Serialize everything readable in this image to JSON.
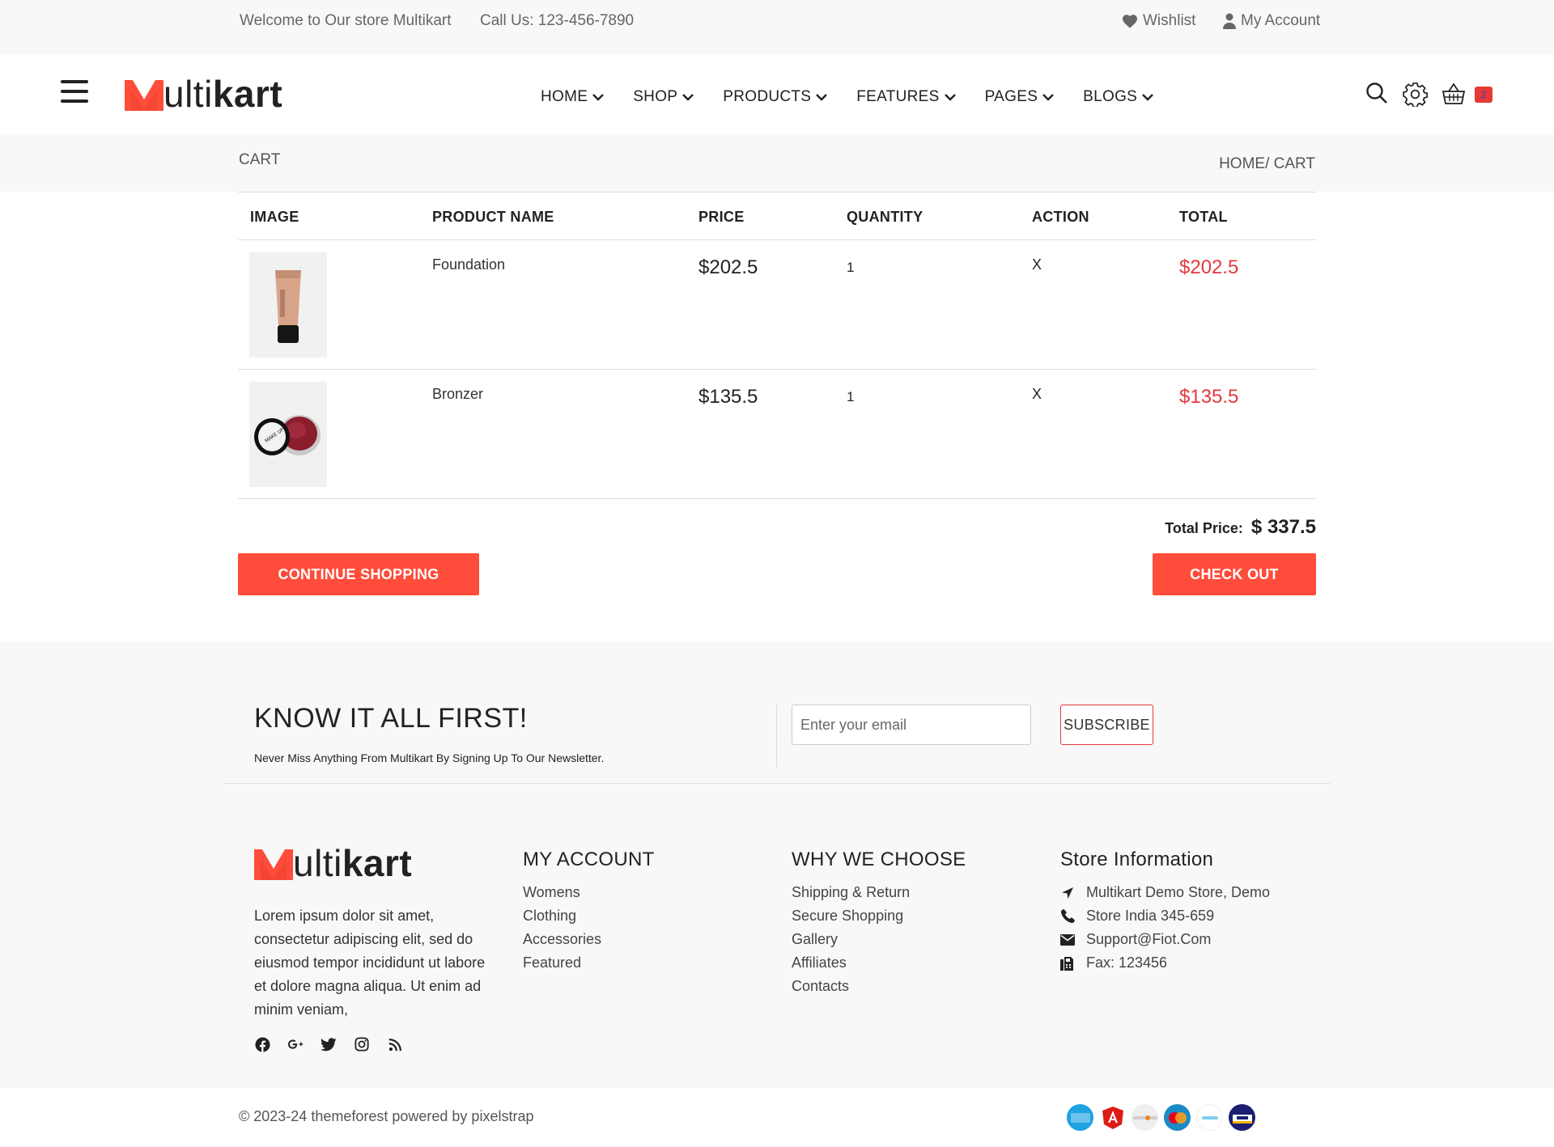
{
  "topbar": {
    "welcome": "Welcome to Our store Multikart",
    "call": "Call Us: 123-456-7890",
    "wishlist": "Wishlist",
    "account": "My Account"
  },
  "brand": {
    "prefix": "ultikart_light",
    "light": "ulti",
    "bold": "kart"
  },
  "nav": {
    "items": [
      "HOME",
      "SHOP",
      "PRODUCTS",
      "FEATURES",
      "PAGES",
      "BLOGS"
    ]
  },
  "header": {
    "cart_count": "2"
  },
  "breadcrumb": {
    "title": "CART",
    "path": "HOME/ CART"
  },
  "cart": {
    "columns": [
      "IMAGE",
      "PRODUCT NAME",
      "PRICE",
      "QUANTITY",
      "ACTION",
      "TOTAL"
    ],
    "items": [
      {
        "name": "Foundation",
        "price": "$202.5",
        "quantity": "1",
        "action": "X",
        "total": "$202.5"
      },
      {
        "name": "Bronzer",
        "price": "$135.5",
        "quantity": "1",
        "action": "X",
        "total": "$135.5"
      }
    ],
    "total_label": "Total Price:",
    "total_value": "$ 337.5",
    "continue_label": "CONTINUE SHOPPING",
    "checkout_label": "CHECK OUT"
  },
  "newsletter": {
    "title": "KNOW IT ALL FIRST!",
    "subtitle": "Never Miss Anything From Multikart By Signing Up To Our Newsletter.",
    "placeholder": "Enter your email",
    "button": "SUBSCRIBE"
  },
  "footer": {
    "about": "Lorem ipsum dolor sit amet, consectetur adipiscing elit, sed do eiusmod tempor incididunt ut labore et dolore magna aliqua. Ut enim ad minim veniam,",
    "my_account": {
      "title": "MY ACCOUNT",
      "links": [
        "Womens",
        "Clothing",
        "Accessories",
        "Featured"
      ]
    },
    "why_choose": {
      "title": "WHY WE CHOOSE",
      "links": [
        "Shipping & Return",
        "Secure Shopping",
        "Gallery",
        "Affiliates",
        "Contacts"
      ]
    },
    "store_info": {
      "title": "Store Information",
      "address": "Multikart Demo Store, Demo",
      "phone": "Store India 345-659",
      "email": "Support@Fiot.Com",
      "fax": "Fax: 123456"
    },
    "copyright": "© 2023-24 themeforest powered by pixelstrap"
  },
  "colors": {
    "accent": "#ff4c3b",
    "price_red": "#e4383f"
  },
  "icons": [
    "heart-icon",
    "user-icon",
    "menu-icon",
    "search-icon",
    "gear-icon",
    "basket-icon",
    "facebook-icon",
    "google-plus-icon",
    "twitter-icon",
    "instagram-icon",
    "rss-icon",
    "location-arrow-icon",
    "phone-icon",
    "envelope-icon",
    "fax-icon"
  ]
}
